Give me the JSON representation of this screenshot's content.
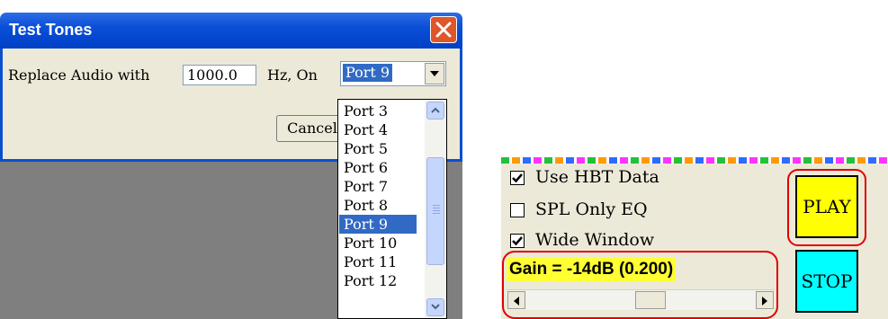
{
  "dialog": {
    "title": "Test Tones",
    "replace_label": "Replace Audio with",
    "hz_value": "1000.0",
    "hz_label": "Hz, On",
    "port_selected": "Port 9",
    "cancel_label": "Cancel",
    "port_options": [
      "Port 3",
      "Port 4",
      "Port 5",
      "Port 6",
      "Port 7",
      "Port 8",
      "Port 9",
      "Port 10",
      "Port 11",
      "Port 12"
    ],
    "selected_index": 6
  },
  "panel": {
    "checkboxes": [
      {
        "label": "Use HBT Data",
        "checked": true
      },
      {
        "label": "SPL Only EQ",
        "checked": false
      },
      {
        "label": "Wide Window",
        "checked": true
      }
    ],
    "gain_label": "Gain = -14dB (0.200)",
    "play_label": "PLAY",
    "stop_label": "STOP",
    "play_color": "#ffff00",
    "stop_color": "#00ffff",
    "gain_slider_fraction": 0.55
  },
  "colors": {
    "titlebar": "#0a4fd6",
    "selection": "#316ac5",
    "highlight_box": "#e00000",
    "gain_background": "#ffff33"
  }
}
